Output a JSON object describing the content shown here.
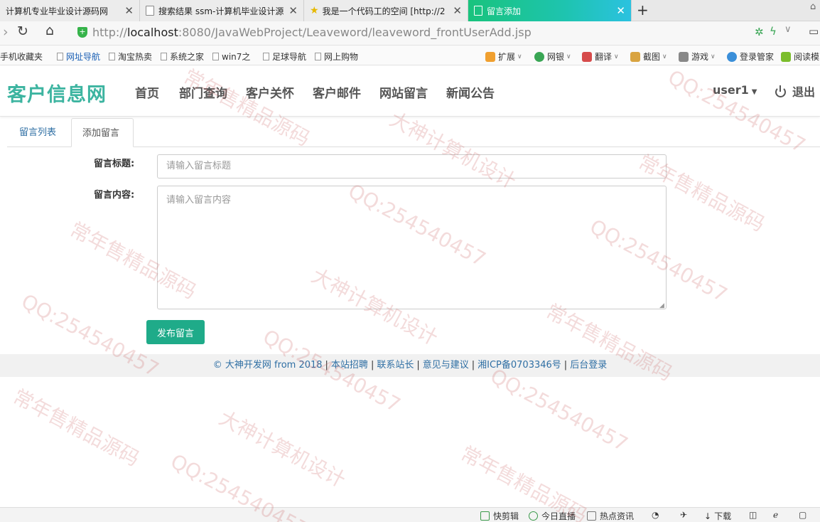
{
  "browser": {
    "tabs": [
      {
        "title": "计算机专业毕业设计源码网",
        "active": false
      },
      {
        "title": "搜索结果 ssm-计算机毕业设计源",
        "active": false
      },
      {
        "title": "我是一个代码工的空间 [http://2",
        "active": false
      },
      {
        "title": "留言添加",
        "active": true
      }
    ],
    "new_tab": "+",
    "url_prefix": "http://",
    "url_host": "localhost",
    "url_rest": ":8080/JavaWebProject/Leaveword/leaveword_frontUserAdd.jsp",
    "bookmarks": [
      "手机收藏夹",
      "网址导航",
      "淘宝热卖",
      "系统之家",
      "win7之",
      "足球导航",
      "网上购物"
    ],
    "extensions": [
      "扩展",
      "网银",
      "翻译",
      "截图",
      "游戏",
      "登录管家",
      "阅读模"
    ]
  },
  "site": {
    "logo": "客户信息网",
    "menu": [
      "首页",
      "部门查询",
      "客户关怀",
      "客户邮件",
      "网站留言",
      "新闻公告"
    ],
    "user": "user1",
    "logout": "退出",
    "accent": "#3cb4a0"
  },
  "subtabs": {
    "list": "留言列表",
    "add": "添加留言"
  },
  "form": {
    "title_label": "留言标题:",
    "title_placeholder": "请输入留言标题",
    "content_label": "留言内容:",
    "content_placeholder": "请输入留言内容",
    "submit": "发布留言",
    "submit_color": "#1fab89"
  },
  "footer": {
    "links": [
      "© 大神开发网 from 2018",
      "本站招聘",
      "联系站长",
      "意见与建议",
      "湘ICP备0703346号",
      "后台登录"
    ]
  },
  "statusbar": [
    "快剪辑",
    "今日直播",
    "热点资讯",
    "下载"
  ],
  "watermarks": [
    "常年售精品源码",
    "QQ:254540457",
    "大神计算机设计"
  ]
}
